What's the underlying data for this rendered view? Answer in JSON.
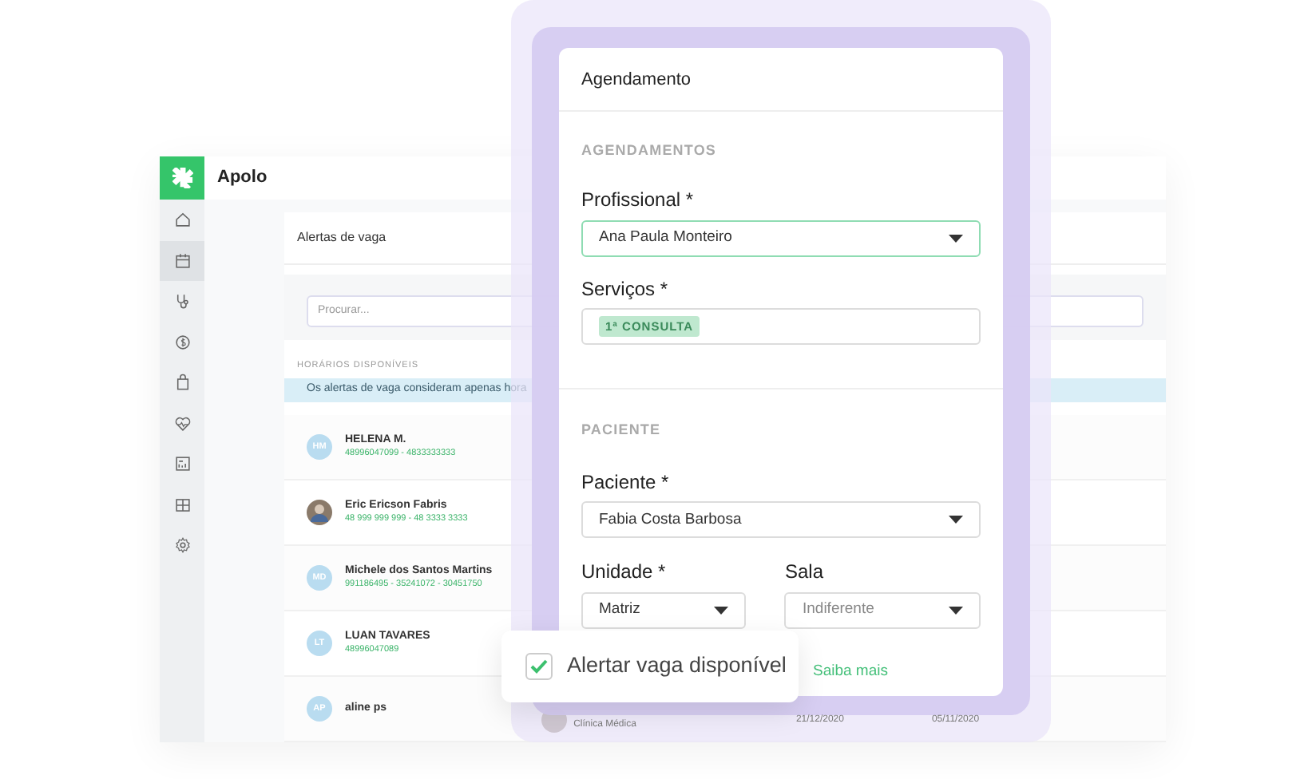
{
  "app": {
    "name": "Apolo"
  },
  "sidebar": {
    "items": [
      {
        "selected": false
      },
      {
        "selected": true
      },
      {
        "selected": false
      },
      {
        "selected": false
      },
      {
        "selected": false
      },
      {
        "selected": false
      },
      {
        "selected": false
      },
      {
        "selected": false
      },
      {
        "selected": false
      }
    ]
  },
  "panel": {
    "title": "Alertas de vaga",
    "search": {
      "placeholder": "Procurar..."
    },
    "section": "HORÁRIOS DISPONÍVEIS",
    "notice": "Os alertas de vaga consideram apenas hora",
    "patients": [
      {
        "kind": "initials",
        "initials": "HM",
        "name": "HELENA M.",
        "phones": "48996047099 - 4833333333"
      },
      {
        "kind": "photo",
        "name": "Eric Ericson Fabris",
        "phones": "48 999 999 999 - 48 3333 3333"
      },
      {
        "kind": "initials",
        "initials": "MD",
        "name": "Michele dos Santos Martins",
        "phones": "991186495 - 35241072 - 30451750"
      },
      {
        "kind": "initials",
        "initials": "LT",
        "name": "LUAN TAVARES",
        "phones": "48996047089"
      },
      {
        "kind": "initials",
        "initials": "AP",
        "name": "aline ps",
        "specialty": "Clínica Médica",
        "date": "21/12/2020",
        "date_2": "05/11/2020"
      }
    ]
  },
  "modal": {
    "title": "Agendamento",
    "section_1": "AGENDAMENTOS",
    "professional": {
      "label": "Profissional *",
      "value": "Ana Paula Monteiro",
      "focused": true
    },
    "services": {
      "label": "Serviços *",
      "tags": [
        "1ª CONSULTA"
      ]
    },
    "section_2": "PACIENTE",
    "patient": {
      "label": "Paciente *",
      "value": "Fabia Costa Barbosa"
    },
    "unit": {
      "label": "Unidade *",
      "value": "Matriz"
    },
    "room": {
      "label": "Sala",
      "placeholder": "Indiferente"
    },
    "link": "Saiba mais"
  },
  "alert_toggle": {
    "label": "Alertar vaga disponível",
    "checked": true
  }
}
